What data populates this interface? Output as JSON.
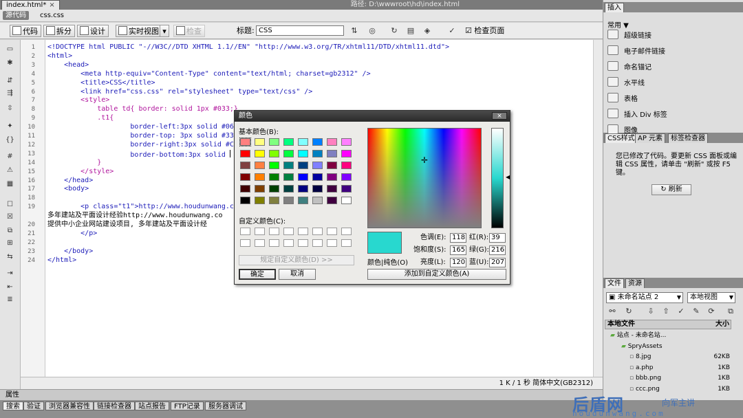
{
  "window": {
    "tab_name": "index.html*",
    "tab_close": "×",
    "path_label": "路径: D:\\wwwroot\\hd\\index.html",
    "win_buttons": [
      "_",
      "□"
    ]
  },
  "related": {
    "source_btn": "源代码",
    "css_file": "css.css"
  },
  "toolbar": {
    "code": "代码",
    "split": "拆分",
    "design": "设计",
    "live_view": "实时视图",
    "inspect": "检查",
    "title_label": "标题:",
    "title_value": "CSS",
    "check_page": "检查页面"
  },
  "code_lines": [
    [
      "<!DOCTYPE html PUBLIC \"-//W3C//DTD XHTML 1.1//EN\" \"http://www.w3.org/TR/xhtml11/DTD/xhtml11.dtd\">",
      "tag"
    ],
    [
      "<html>",
      "tag"
    ],
    [
      "    <head>",
      "tag"
    ],
    [
      "        <meta http-equiv=\"Content-Type\" content=\"text/html; charset=gb2312\" />",
      "tag"
    ],
    [
      "        <title>CSS</title>",
      "tag"
    ],
    [
      "        <link href=\"css.css\" rel=\"stylesheet\" type=\"text/css\" />",
      "tag"
    ],
    [
      "        <style>",
      "css"
    ],
    [
      "            table td{ border: solid 1px #033;}",
      "css"
    ],
    [
      "            .t1{",
      "css"
    ],
    [
      "                    border-left:3px solid #06",
      "tag"
    ],
    [
      "                    border-top: 3px solid #330",
      "tag"
    ],
    [
      "                    border-right:3px solid #C0",
      "tag"
    ],
    [
      "                    border-bottom:3px solid ",
      "tag"
    ],
    [
      "            }",
      "css"
    ],
    [
      "        </style>",
      "css"
    ],
    [
      "    </head>",
      "tag"
    ],
    [
      "    <body>",
      "tag"
    ],
    [
      "",
      "tag"
    ],
    [
      "        <p class=\"t1\">http://www.houdunwang.com",
      "tag"
    ],
    [
      "多年建站及平面设计经验http://www.houdunwang.co",
      "txt"
    ],
    [
      "提供中小企业网站建设项目, 多年建站及平面设计经",
      "txt"
    ],
    [
      "        </p>",
      "tag"
    ],
    [
      "",
      "tag"
    ],
    [
      "    </body>",
      "tag"
    ],
    [
      "</html>",
      "tag"
    ]
  ],
  "line_numbers": [
    "1",
    "2",
    "3",
    "4",
    "5",
    "6",
    "7",
    "8",
    "9",
    "10",
    "11",
    "12",
    "13",
    "14",
    "15",
    "16",
    "17",
    "18",
    "19",
    "",
    "20",
    "21",
    "22",
    "23",
    "24"
  ],
  "status": "1 K / 1 秒  简体中文(GB2312)",
  "properties_label": "属性",
  "bottom_tabs": [
    "搜索",
    "验证",
    "浏览器兼容性",
    "链接检查器",
    "站点报告",
    "FTP记录",
    "服务器调试"
  ],
  "watermark": {
    "logo": "后盾网",
    "sub": "向军主讲",
    "url": "houdunwang.com"
  },
  "right": {
    "insert_tab": "插入",
    "insert_category": "常用 ▼",
    "insert_items": [
      "超级链接",
      "电子邮件链接",
      "命名锚记",
      "水平线",
      "表格",
      "插入 Div 标签",
      "图像"
    ],
    "css_tabs": [
      "CSS样式",
      "AP 元素",
      "标签检查器"
    ],
    "css_message": "您已修改了代码。要更新 CSS 面板或编辑 CSS 属性，请单击 \"刷新\" 或按 F5 键。",
    "refresh_btn": "刷新",
    "files_tabs": [
      "文件",
      "资源"
    ],
    "site_select": "未命名站点 2",
    "view_select": "本地视图",
    "file_header": "本地文件",
    "file_size_header": "大小",
    "files": [
      {
        "name": "站点 - 未命名站...",
        "size": ""
      },
      {
        "name": "SpryAssets",
        "size": ""
      },
      {
        "name": "8.jpg",
        "size": "62KB"
      },
      {
        "name": "a.php",
        "size": "1KB"
      },
      {
        "name": "bbb.png",
        "size": "1KB"
      },
      {
        "name": "ccc.png",
        "size": "1KB"
      }
    ]
  },
  "color_dialog": {
    "title": "颜色",
    "close": "×",
    "basic_label": "基本颜色(B):",
    "custom_label": "自定义颜色(C):",
    "define_btn": "规定自定义颜色(D) >>",
    "ok": "确定",
    "cancel": "取消",
    "preview_label": "颜色|纯色(O)",
    "add_custom": "添加到自定义颜色(A)",
    "fields": {
      "hue_label": "色调(E):",
      "hue": "118",
      "sat_label": "饱和度(S):",
      "sat": "165",
      "lum_label": "亮度(L):",
      "lum": "120",
      "red_label": "红(R):",
      "red": "39",
      "green_label": "绿(G):",
      "green": "216",
      "blue_label": "蓝(U):",
      "blue": "207"
    },
    "selected_color": "#28d8cf",
    "basic_colors": [
      [
        "#ff8080",
        "#ffff80",
        "#80ff80",
        "#00ff80",
        "#80ffff",
        "#0080ff",
        "#ff80c0",
        "#ff80ff"
      ],
      [
        "#ff0000",
        "#ffff00",
        "#80ff00",
        "#00ff40",
        "#00ffff",
        "#0080c0",
        "#8080c0",
        "#ff00ff"
      ],
      [
        "#804040",
        "#ff8040",
        "#00ff00",
        "#008080",
        "#004080",
        "#8080ff",
        "#800040",
        "#ff0080"
      ],
      [
        "#800000",
        "#ff8000",
        "#008000",
        "#008040",
        "#0000ff",
        "#0000a0",
        "#800080",
        "#8000ff"
      ],
      [
        "#400000",
        "#804000",
        "#004000",
        "#004040",
        "#000080",
        "#000040",
        "#400040",
        "#400080"
      ],
      [
        "#000000",
        "#808000",
        "#808040",
        "#808080",
        "#408080",
        "#c0c0c0",
        "#400040",
        "#ffffff"
      ]
    ]
  }
}
